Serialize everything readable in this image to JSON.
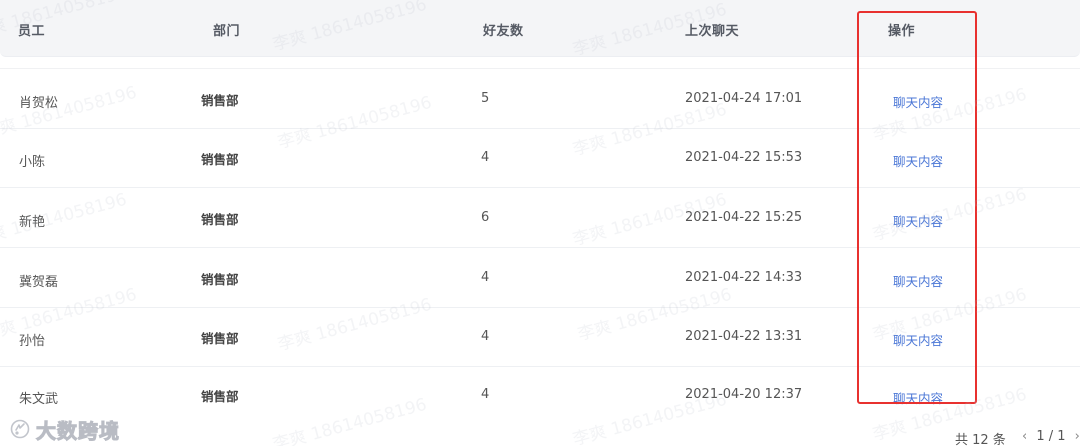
{
  "table": {
    "headers": {
      "employee": "员工",
      "department": "部门",
      "friends": "好友数",
      "last_chat": "上次聊天",
      "action": "操作"
    },
    "rows": [
      {
        "employee": "肖贺松",
        "department": "销售部",
        "friends": "5",
        "last_chat": "2021-04-24 17:01",
        "action": "聊天内容"
      },
      {
        "employee": "小陈",
        "department": "销售部",
        "friends": "4",
        "last_chat": "2021-04-22 15:53",
        "action": "聊天内容"
      },
      {
        "employee": "新艳",
        "department": "销售部",
        "friends": "6",
        "last_chat": "2021-04-22 15:25",
        "action": "聊天内容"
      },
      {
        "employee": "冀贺磊",
        "department": "销售部",
        "friends": "4",
        "last_chat": "2021-04-22 14:33",
        "action": "聊天内容"
      },
      {
        "employee": "孙怡",
        "department": "销售部",
        "friends": "4",
        "last_chat": "2021-04-22 13:31",
        "action": "聊天内容"
      },
      {
        "employee": "朱文武",
        "department": "销售部",
        "friends": "4",
        "last_chat": "2021-04-20 12:37",
        "action": "聊天内容"
      }
    ]
  },
  "pagination": {
    "total_label": "共 12 条",
    "prev_icon": "chevron-left-icon",
    "pages_label": "1 / 1",
    "next_icon": "chevron-right-icon"
  },
  "watermark": {
    "text": "李爽 18614058196"
  },
  "logo": {
    "brand": "大数跨境",
    "icon": "logo-icon"
  },
  "colors": {
    "header_bg": "#f4f5f7",
    "link": "#4a76d6",
    "highlight_border": "#e8312f"
  }
}
